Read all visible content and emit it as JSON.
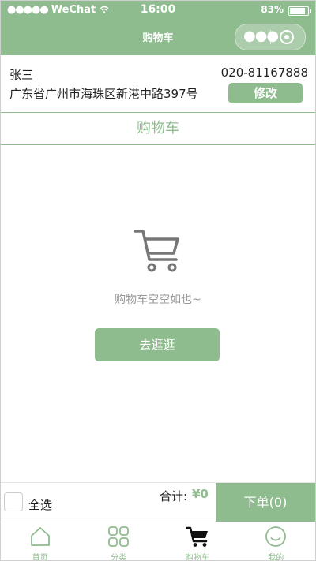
{
  "status_bar": {
    "carrier": "WeChat",
    "signal": "●●●●●",
    "time": "16:00",
    "battery": "83%"
  },
  "nav": {
    "title": "购物车",
    "more_icon": "more-dots-icon",
    "target_icon": "target-icon"
  },
  "address": {
    "name": "张三",
    "phone": "020-81167888",
    "address": "广东省广州市海珠区新港中路397号",
    "edit_label": "修改"
  },
  "section_title": "购物车",
  "empty": {
    "icon": "cart-icon",
    "message": "购物车空空如也~",
    "button_label": "去逛逛"
  },
  "checkout": {
    "select_all_label": "全选",
    "select_all_checked": false,
    "total_label": "合计:",
    "total_value": "¥0",
    "order_button_label": "下单(0)"
  },
  "tabbar": {
    "items": [
      {
        "label": "首页",
        "icon": "home-icon"
      },
      {
        "label": "分类",
        "icon": "category-icon"
      },
      {
        "label": "购物车",
        "icon": "cart-icon",
        "active": true
      },
      {
        "label": "我的",
        "icon": "smiley-icon"
      }
    ]
  },
  "colors": {
    "accent": "#8fbc8f",
    "text": "#222222",
    "muted": "#999999"
  }
}
